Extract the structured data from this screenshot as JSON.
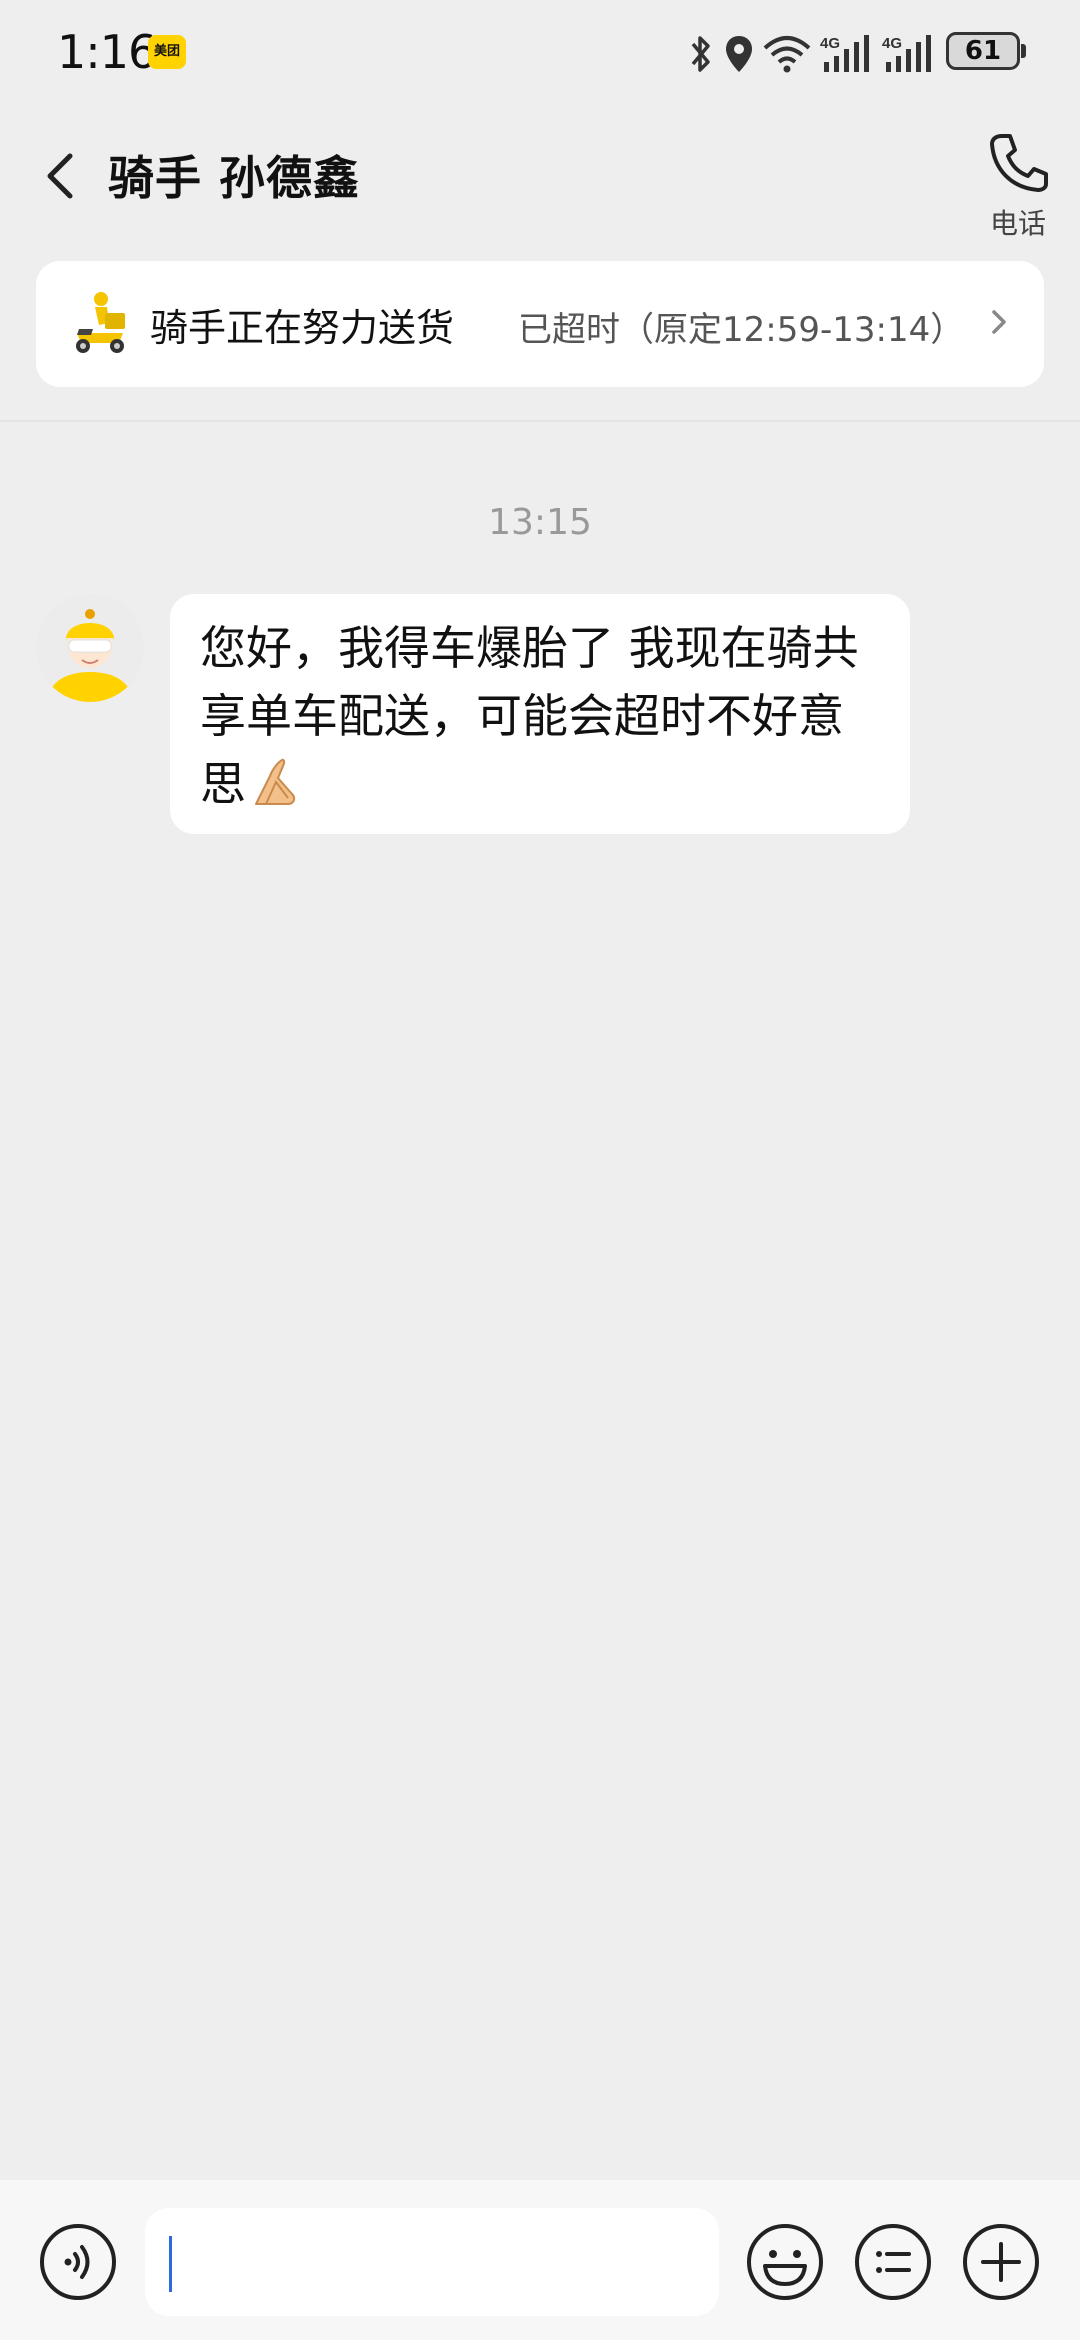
{
  "status_bar": {
    "time": "1:16",
    "app_badge": "美团",
    "battery": "61"
  },
  "header": {
    "title": "骑手 孙德鑫",
    "phone_label": "电话"
  },
  "delivery": {
    "status": "骑手正在努力送货",
    "timeout": "已超时（原定12:59-13:14）"
  },
  "chat": {
    "timestamp": "13:15",
    "messages": [
      {
        "sender": "rider",
        "text": "您好，我得车爆胎了 我现在骑共享单车配送，可能会超时不好意思"
      }
    ]
  },
  "input": {
    "placeholder": ""
  },
  "colors": {
    "background": "#eeeeee",
    "card": "#ffffff",
    "brand_yellow": "#ffd200",
    "caret": "#2d6bdc"
  }
}
